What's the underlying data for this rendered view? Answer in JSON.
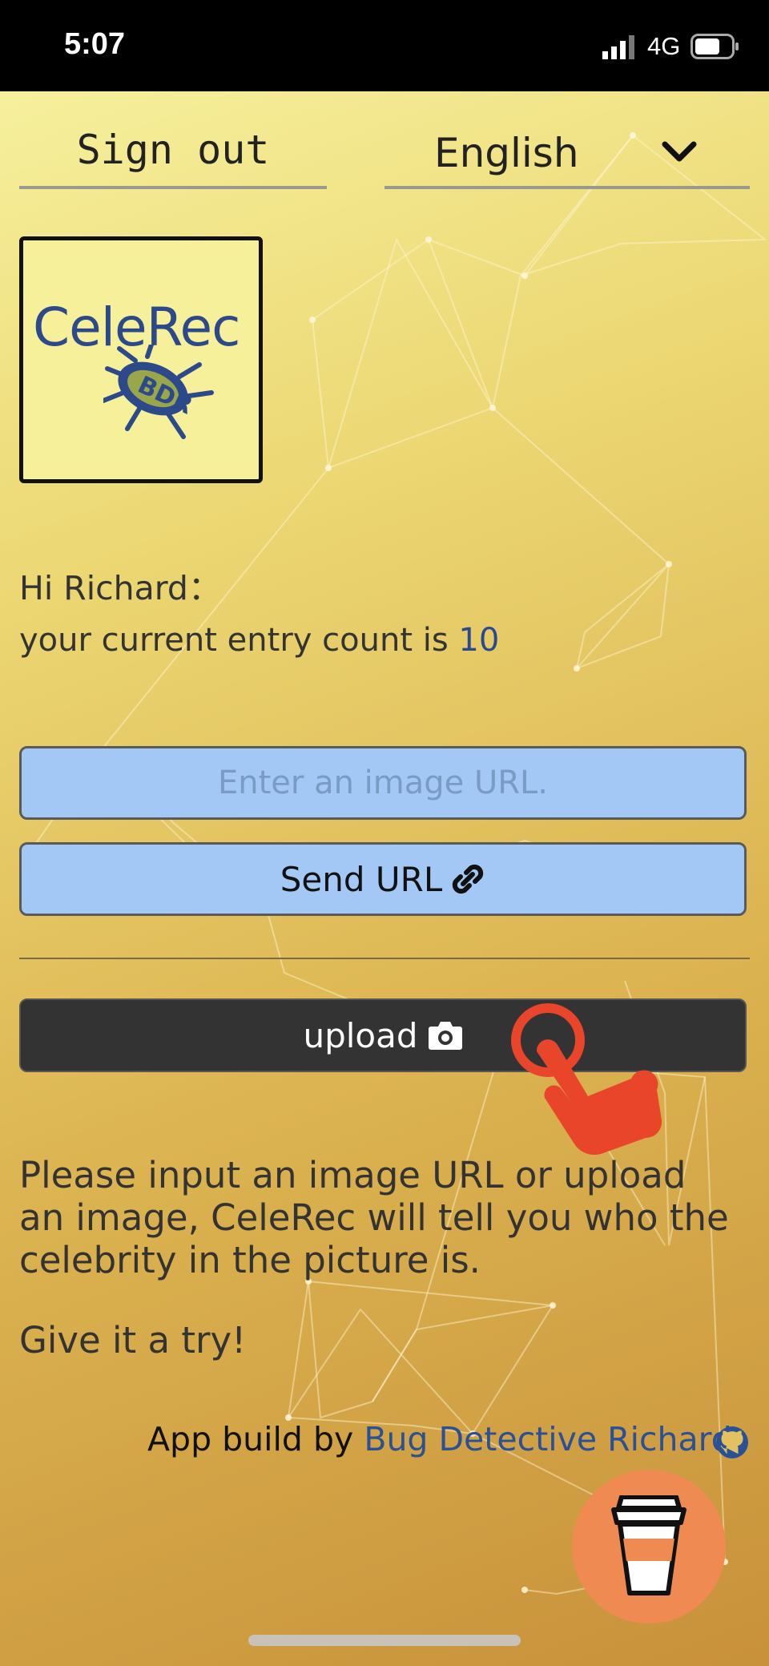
{
  "status_bar": {
    "time": "5:07",
    "network": "4G",
    "icons": [
      "signal-bars-icon",
      "battery-icon"
    ]
  },
  "header": {
    "sign_out_label": "Sign out",
    "language": {
      "selected": "English",
      "icon": "chevron-down-icon"
    }
  },
  "logo": {
    "text": "CeleRec",
    "icon": "bug-icon"
  },
  "greeting": {
    "hello": "Hi Richard：",
    "count_prefix": "your current entry count is ",
    "count_value": "10"
  },
  "url_form": {
    "placeholder": "Enter an image URL.",
    "value": "",
    "send_label": "Send URL",
    "send_icon": "link-icon"
  },
  "upload": {
    "label": "upload",
    "icon": "camera-icon",
    "hint_icon": "tap-hand-icon"
  },
  "description": {
    "text": "Please input an image URL or upload an image, CeleRec will tell you who the celebrity in the picture is.",
    "cta": "Give it a try!"
  },
  "footer": {
    "credit_prefix": "App build by ",
    "author": "Bug Detective Richard",
    "icon": "github-icon"
  },
  "coffee_button": {
    "icon": "coffee-cup-icon"
  },
  "colors": {
    "accent_blue": "#a3c8f5",
    "link_blue": "#2a5196",
    "upload_dark": "#333333",
    "coffee_orange": "#ef8b52",
    "hint_red": "#e8452a"
  }
}
